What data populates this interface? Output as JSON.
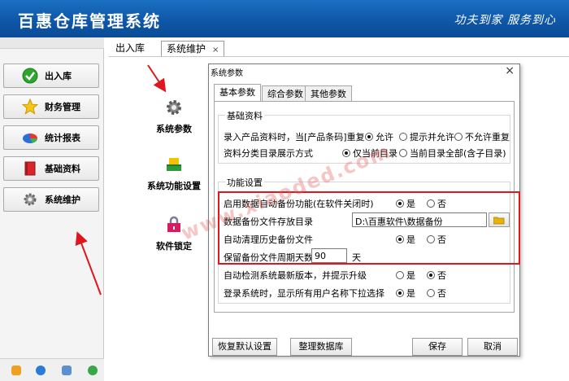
{
  "app": {
    "title": "百惠仓库管理系统",
    "slogan": "功夫到家  服务到心"
  },
  "sidebar": {
    "items": [
      {
        "label": "出入库",
        "icon": "checkmark-icon"
      },
      {
        "label": "财务管理",
        "icon": "star-icon"
      },
      {
        "label": "统计报表",
        "icon": "pie-chart-icon"
      },
      {
        "label": "基础资料",
        "icon": "book-icon"
      },
      {
        "label": "系统维护",
        "icon": "gear-icon"
      }
    ],
    "footer_icons": [
      "edit-icon",
      "info-icon",
      "monitor-icon",
      "refresh-icon"
    ]
  },
  "tabs": [
    {
      "label": "出入库",
      "active": false
    },
    {
      "label": "系统维护",
      "active": true,
      "close": "×"
    }
  ],
  "functions": [
    {
      "label": "系统参数",
      "icon": "gear-icon"
    },
    {
      "label": "系统功能设置",
      "icon": "blocks-icon"
    },
    {
      "label": "软件锁定",
      "icon": "lock-icon"
    }
  ],
  "dialog": {
    "title": "系统参数",
    "close": "×",
    "tabs": [
      "基本参数",
      "综合参数",
      "其他参数"
    ],
    "group_basic": {
      "label": "基础资料",
      "row1": {
        "label": "录入产品资料时，当[产品条码]重复",
        "options": [
          "允许",
          "提示并允许",
          "不允许重复"
        ],
        "selected": "允许"
      },
      "row2": {
        "label": "资料分类目录展示方式",
        "options": [
          "仅当前目录",
          "当前目录全部(含子目录)"
        ],
        "selected": "仅当前目录"
      }
    },
    "group_func": {
      "label": "功能设置",
      "auto_backup": {
        "label": "启用数据自动备份功能(在软件关闭时)",
        "options": [
          "是",
          "否"
        ],
        "selected": "是"
      },
      "backup_dir": {
        "label": "数据备份文件存放目录",
        "value": "D:\\百惠软件\\数据备份"
      },
      "auto_clean": {
        "label": "自动清理历史备份文件",
        "options": [
          "是",
          "否"
        ],
        "selected": "是"
      },
      "keep_days": {
        "label": "保留备份文件周期天数",
        "value": "90",
        "unit": "天"
      },
      "auto_update": {
        "label": "自动检测系统最新版本，并提示升级",
        "options": [
          "是",
          "否"
        ],
        "selected": "否"
      },
      "login_list": {
        "label": "登录系统时，显示所有用户名称下拉选择",
        "options": [
          "是",
          "否"
        ],
        "selected": "是"
      }
    },
    "buttons": {
      "restore_default": "恢复默认设置",
      "organize_db": "整理数据库",
      "save": "保存",
      "cancel": "取消"
    }
  },
  "watermark": "www.xiaoded.com",
  "colors": {
    "header": "#0f57a8",
    "highlight": "#e0161f",
    "arrow": "#e0161f"
  }
}
